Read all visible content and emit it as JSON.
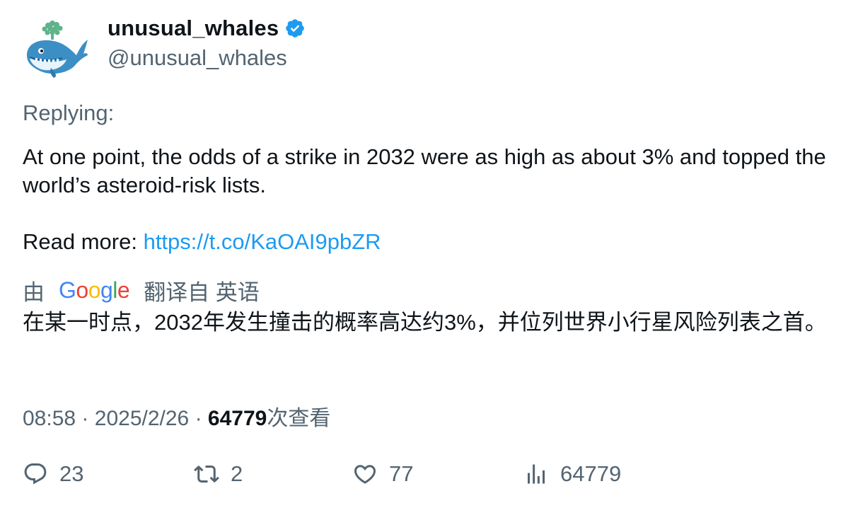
{
  "author": {
    "name": "unusual_whales",
    "handle": "@unusual_whales",
    "avatar_icon": "whale-avatar",
    "verified_color": "#1d9bf0"
  },
  "tweet": {
    "replying_label": "Replying:",
    "text_line1": "At one point, the odds of a strike in 2032 were as high as about 3% and topped the world’s asteroid-risk lists.",
    "read_more_label": "Read more: ",
    "link": "https://t.co/KaOAI9pbZR"
  },
  "translation": {
    "by_label": "由",
    "google_logo_text": "Google",
    "translated_from_label": "翻译自 英语",
    "text": "在某一时点，2032年发生撞击的概率高达约3%，并位列世界小行星风险列表之首。"
  },
  "meta": {
    "time": "08:58",
    "separator": "·",
    "date": "2025/2/26",
    "views_count": "64779",
    "views_label": "次查看"
  },
  "actions": {
    "replies": "23",
    "retweets": "2",
    "likes": "77",
    "views": "64779"
  }
}
